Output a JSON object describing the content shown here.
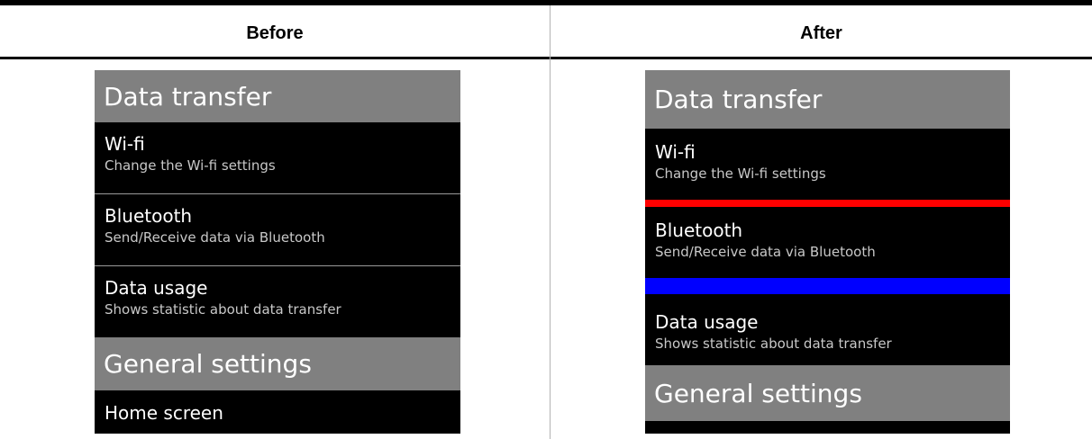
{
  "columns": {
    "before_label": "Before",
    "after_label": "After"
  },
  "before": {
    "section1": "Data transfer",
    "items": [
      {
        "title": "Wi-fi",
        "subtitle": "Change the Wi-fi settings"
      },
      {
        "title": "Bluetooth",
        "subtitle": "Send/Receive data via Bluetooth"
      },
      {
        "title": "Data usage",
        "subtitle": "Shows statistic about data transfer"
      }
    ],
    "section2": "General settings",
    "partial_item": "Home screen"
  },
  "after": {
    "section1": "Data transfer",
    "items": [
      {
        "title": "Wi-fi",
        "subtitle": "Change the Wi-fi settings"
      },
      {
        "title": "Bluetooth",
        "subtitle": "Send/Receive data via Bluetooth"
      },
      {
        "title": "Data usage",
        "subtitle": "Shows statistic about data transfer"
      }
    ],
    "section2": "General settings",
    "separator_colors": [
      "#ff0000",
      "#0000ff"
    ]
  },
  "colors": {
    "header_bg": "#808080",
    "list_bg": "#000000",
    "text": "#ffffff"
  }
}
